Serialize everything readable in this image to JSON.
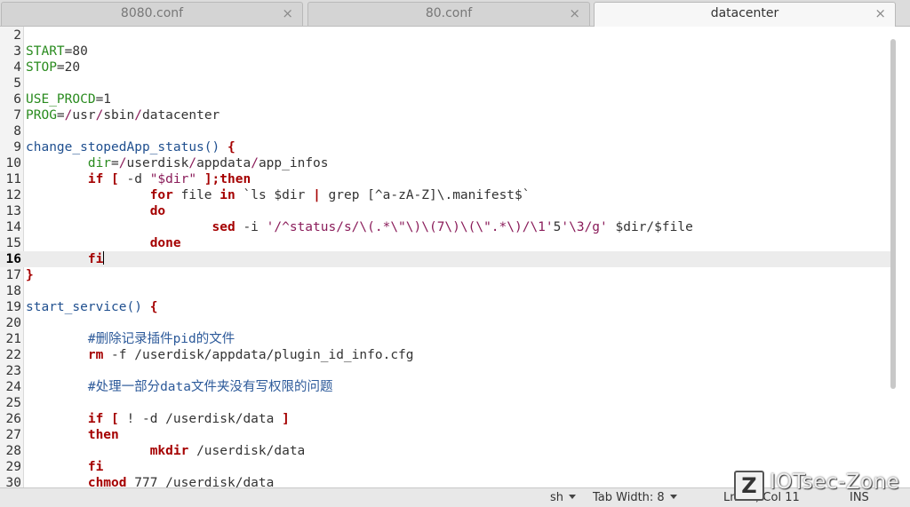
{
  "tabs": [
    {
      "label": "8080.conf",
      "active": false
    },
    {
      "label": "80.conf",
      "active": false
    },
    {
      "label": "datacenter",
      "active": true
    }
  ],
  "tab_close_glyph": "×",
  "current_line": 16,
  "lines": [
    {
      "n": "2",
      "tokens": []
    },
    {
      "n": "3",
      "tokens": [
        [
          "var",
          "START"
        ],
        [
          "plain",
          "=80"
        ]
      ]
    },
    {
      "n": "4",
      "tokens": [
        [
          "var",
          "STOP"
        ],
        [
          "plain",
          "=20"
        ]
      ]
    },
    {
      "n": "5",
      "tokens": []
    },
    {
      "n": "6",
      "tokens": [
        [
          "var",
          "USE_PROCD"
        ],
        [
          "plain",
          "=1"
        ]
      ]
    },
    {
      "n": "7",
      "tokens": [
        [
          "var",
          "PROG"
        ],
        [
          "plain",
          "="
        ],
        [
          "path",
          "/"
        ],
        [
          "plain",
          "usr"
        ],
        [
          "path",
          "/"
        ],
        [
          "plain",
          "sbin"
        ],
        [
          "path",
          "/"
        ],
        [
          "plain",
          "datacenter"
        ]
      ]
    },
    {
      "n": "8",
      "tokens": []
    },
    {
      "n": "9",
      "tokens": [
        [
          "func",
          "change_stopedApp_status() "
        ],
        [
          "brace",
          "{"
        ]
      ]
    },
    {
      "n": "10",
      "tokens": [
        [
          "plain",
          "        "
        ],
        [
          "var",
          "dir"
        ],
        [
          "plain",
          "="
        ],
        [
          "path",
          "/"
        ],
        [
          "plain",
          "userdisk"
        ],
        [
          "path",
          "/"
        ],
        [
          "plain",
          "appdata"
        ],
        [
          "path",
          "/"
        ],
        [
          "plain",
          "app_infos"
        ]
      ]
    },
    {
      "n": "11",
      "tokens": [
        [
          "plain",
          "        "
        ],
        [
          "kw",
          "if"
        ],
        [
          "plain",
          " "
        ],
        [
          "kw",
          "["
        ],
        [
          "plain",
          " -d "
        ],
        [
          "str",
          "\"$dir\""
        ],
        [
          "plain",
          " "
        ],
        [
          "kw",
          "];then"
        ]
      ]
    },
    {
      "n": "12",
      "tokens": [
        [
          "plain",
          "                "
        ],
        [
          "kw",
          "for"
        ],
        [
          "plain",
          " file "
        ],
        [
          "kw",
          "in"
        ],
        [
          "plain",
          " `ls $dir "
        ],
        [
          "kw",
          "|"
        ],
        [
          "plain",
          " grep [^a-zA-Z]\\.manifest$`"
        ]
      ]
    },
    {
      "n": "13",
      "tokens": [
        [
          "plain",
          "                "
        ],
        [
          "kw",
          "do"
        ]
      ]
    },
    {
      "n": "14",
      "tokens": [
        [
          "plain",
          "                        "
        ],
        [
          "kw",
          "sed"
        ],
        [
          "plain",
          " -i "
        ],
        [
          "str",
          "'/^status/s/\\(.*\\\"\\)\\(7\\)\\(\\\".*\\)/\\1'"
        ],
        [
          "plain",
          "5"
        ],
        [
          "str",
          "'\\3/g'"
        ],
        [
          "plain",
          " $dir/$file"
        ]
      ]
    },
    {
      "n": "15",
      "tokens": [
        [
          "plain",
          "                "
        ],
        [
          "kw",
          "done"
        ]
      ]
    },
    {
      "n": "16",
      "tokens": [
        [
          "plain",
          "        "
        ],
        [
          "kw",
          "fi"
        ]
      ],
      "caret": true
    },
    {
      "n": "17",
      "tokens": [
        [
          "brace",
          "}"
        ]
      ]
    },
    {
      "n": "18",
      "tokens": []
    },
    {
      "n": "19",
      "tokens": [
        [
          "func",
          "start_service() "
        ],
        [
          "brace",
          "{"
        ]
      ]
    },
    {
      "n": "20",
      "tokens": []
    },
    {
      "n": "21",
      "tokens": [
        [
          "plain",
          "        "
        ],
        [
          "cmt",
          "#删除记录插件pid的文件"
        ]
      ]
    },
    {
      "n": "22",
      "tokens": [
        [
          "plain",
          "        "
        ],
        [
          "kw",
          "rm"
        ],
        [
          "plain",
          " -f /userdisk/appdata/plugin_id_info.cfg"
        ]
      ]
    },
    {
      "n": "23",
      "tokens": []
    },
    {
      "n": "24",
      "tokens": [
        [
          "plain",
          "        "
        ],
        [
          "cmt",
          "#处理一部分data文件夹没有写权限的问题"
        ]
      ]
    },
    {
      "n": "25",
      "tokens": []
    },
    {
      "n": "26",
      "tokens": [
        [
          "plain",
          "        "
        ],
        [
          "kw",
          "if"
        ],
        [
          "plain",
          " "
        ],
        [
          "kw",
          "["
        ],
        [
          "plain",
          " ! -d /userdisk/data "
        ],
        [
          "kw",
          "]"
        ]
      ]
    },
    {
      "n": "27",
      "tokens": [
        [
          "plain",
          "        "
        ],
        [
          "kw",
          "then"
        ]
      ]
    },
    {
      "n": "28",
      "tokens": [
        [
          "plain",
          "                "
        ],
        [
          "kw",
          "mkdir"
        ],
        [
          "plain",
          " /userdisk/data"
        ]
      ]
    },
    {
      "n": "29",
      "tokens": [
        [
          "plain",
          "        "
        ],
        [
          "kw",
          "fi"
        ]
      ]
    },
    {
      "n": "30",
      "tokens": [
        [
          "plain",
          "        "
        ],
        [
          "kw",
          "chmod"
        ],
        [
          "plain",
          " 777 /userdisk/data"
        ]
      ]
    }
  ],
  "statusbar": {
    "language": "sh",
    "tab_width": "Tab Width: 8",
    "position": "Ln 16, Col 11",
    "mode": "INS"
  },
  "watermark": {
    "logo_letter": "Z",
    "text": "IOTsec-Zone"
  }
}
